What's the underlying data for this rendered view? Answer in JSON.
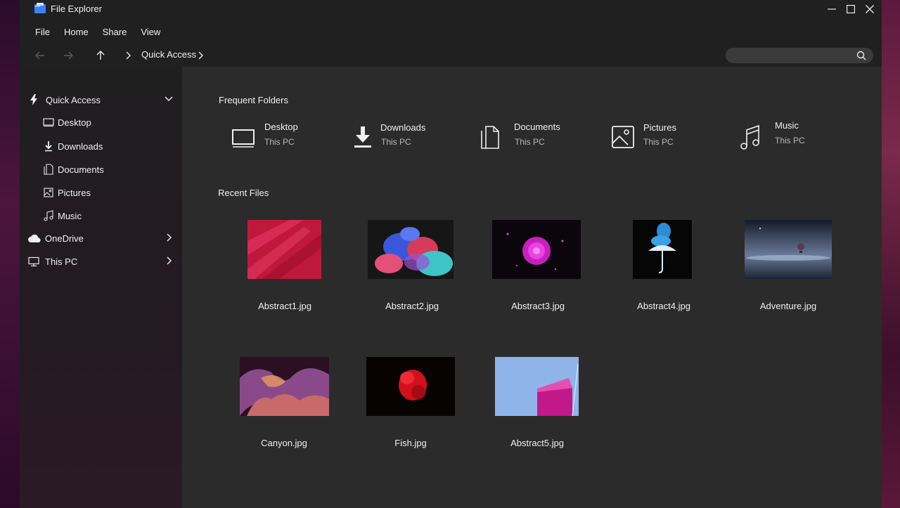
{
  "window": {
    "title": "File Explorer"
  },
  "menu": {
    "file": "File",
    "home": "Home",
    "share": "Share",
    "view": "View"
  },
  "nav": {
    "breadcrumb": "Quick Access",
    "search_placeholder": ""
  },
  "sidebar": {
    "quick_access": "Quick Access",
    "items": [
      "Desktop",
      "Downloads",
      "Documents",
      "Pictures",
      "Music"
    ],
    "onedrive": "OneDrive",
    "thispc": "This PC"
  },
  "frequent": {
    "title": "Frequent Folders",
    "folders": [
      {
        "name": "Desktop",
        "location": "This PC",
        "icon": "monitor-icon"
      },
      {
        "name": "Downloads",
        "location": "This PC",
        "icon": "download-icon"
      },
      {
        "name": "Documents",
        "location": "This PC",
        "icon": "documents-icon"
      },
      {
        "name": "Pictures",
        "location": "This PC",
        "icon": "pictures-icon"
      },
      {
        "name": "Music",
        "location": "This PC",
        "icon": "music-icon"
      }
    ]
  },
  "recent": {
    "title": "Recent Files",
    "files": [
      "Abstract1.jpg",
      "Abstract2.jpg",
      "Abstract3.jpg",
      "Abstract4.jpg",
      "Adventure.jpg",
      "Canyon.jpg",
      "Fish.jpg",
      "Abstract5.jpg"
    ]
  },
  "colors": {
    "window_bg": "#202020",
    "content_bg": "#2b2b2b",
    "text": "#f0f0f0",
    "accent": "#3b82f6"
  }
}
